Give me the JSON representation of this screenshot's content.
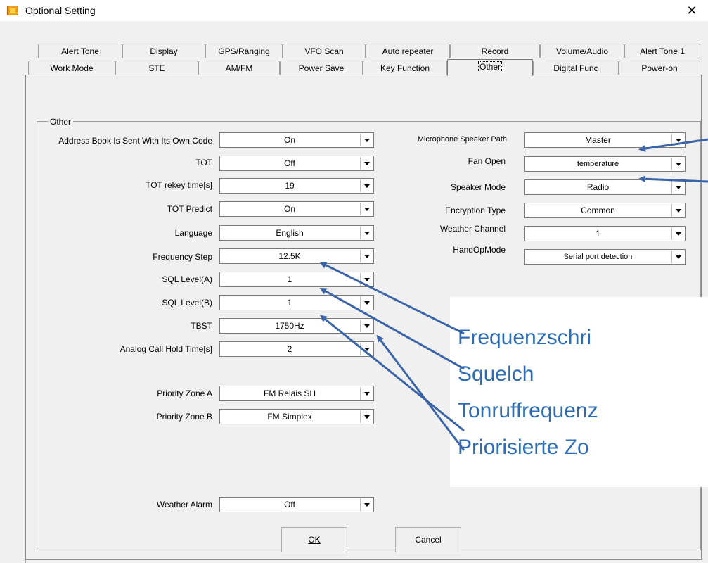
{
  "window": {
    "title": "Optional Setting",
    "close_glyph": "✕"
  },
  "tabs_row1": [
    "Alert Tone",
    "Display",
    "GPS/Ranging",
    "VFO Scan",
    "Auto repeater",
    "Record",
    "Volume/Audio",
    "Alert Tone 1"
  ],
  "tabs_row2": [
    "Work Mode",
    "STE",
    "AM/FM",
    "Power Save",
    "Key Function",
    "Other",
    "Digital Func",
    "Power-on"
  ],
  "group_title": "Other",
  "left_fields": {
    "address_book": {
      "label": "Address Book Is Sent With Its Own Code",
      "value": "On"
    },
    "tot": {
      "label": "TOT",
      "value": "Off"
    },
    "tot_rekey": {
      "label": "TOT rekey  time[s]",
      "value": "19"
    },
    "tot_predict": {
      "label": "TOT Predict",
      "value": "On"
    },
    "language": {
      "label": "Language",
      "value": "English"
    },
    "frequency_step": {
      "label": "Frequency Step",
      "value": "12.5K"
    },
    "sql_a": {
      "label": "SQL Level(A)",
      "value": "1"
    },
    "sql_b": {
      "label": "SQL Level(B)",
      "value": "1"
    },
    "tbst": {
      "label": "TBST",
      "value": "1750Hz"
    },
    "analog_hold": {
      "label": "Analog Call Hold Time[s]",
      "value": "2"
    },
    "priority_a": {
      "label": "Priority Zone A",
      "value": "FM Relais SH"
    },
    "priority_b": {
      "label": "Priority Zone B",
      "value": "FM Simplex"
    },
    "weather_alarm": {
      "label": "Weather Alarm",
      "value": "Off"
    }
  },
  "right_fields": {
    "mic_speaker": {
      "label": "Microphone Speaker Path",
      "value": "Master"
    },
    "fan_open": {
      "label": "Fan Open",
      "value": "temperature"
    },
    "speaker_mode": {
      "label": "Speaker Mode",
      "value": "Radio"
    },
    "encryption": {
      "label": "Encryption Type",
      "value": "Common"
    },
    "weather_channel": {
      "label": "Weather Channel",
      "value": "1"
    },
    "handop": {
      "label": "HandOpMode",
      "value": "Serial port detection"
    }
  },
  "buttons": {
    "ok": "OK",
    "cancel": "Cancel"
  },
  "annotations": [
    "Frequenzschri",
    "Squelch",
    "Tonruffrequenz",
    "Priorisierte Zo"
  ],
  "colors": {
    "annotation": "#2e6db4",
    "arrow": "#3b64a8"
  }
}
